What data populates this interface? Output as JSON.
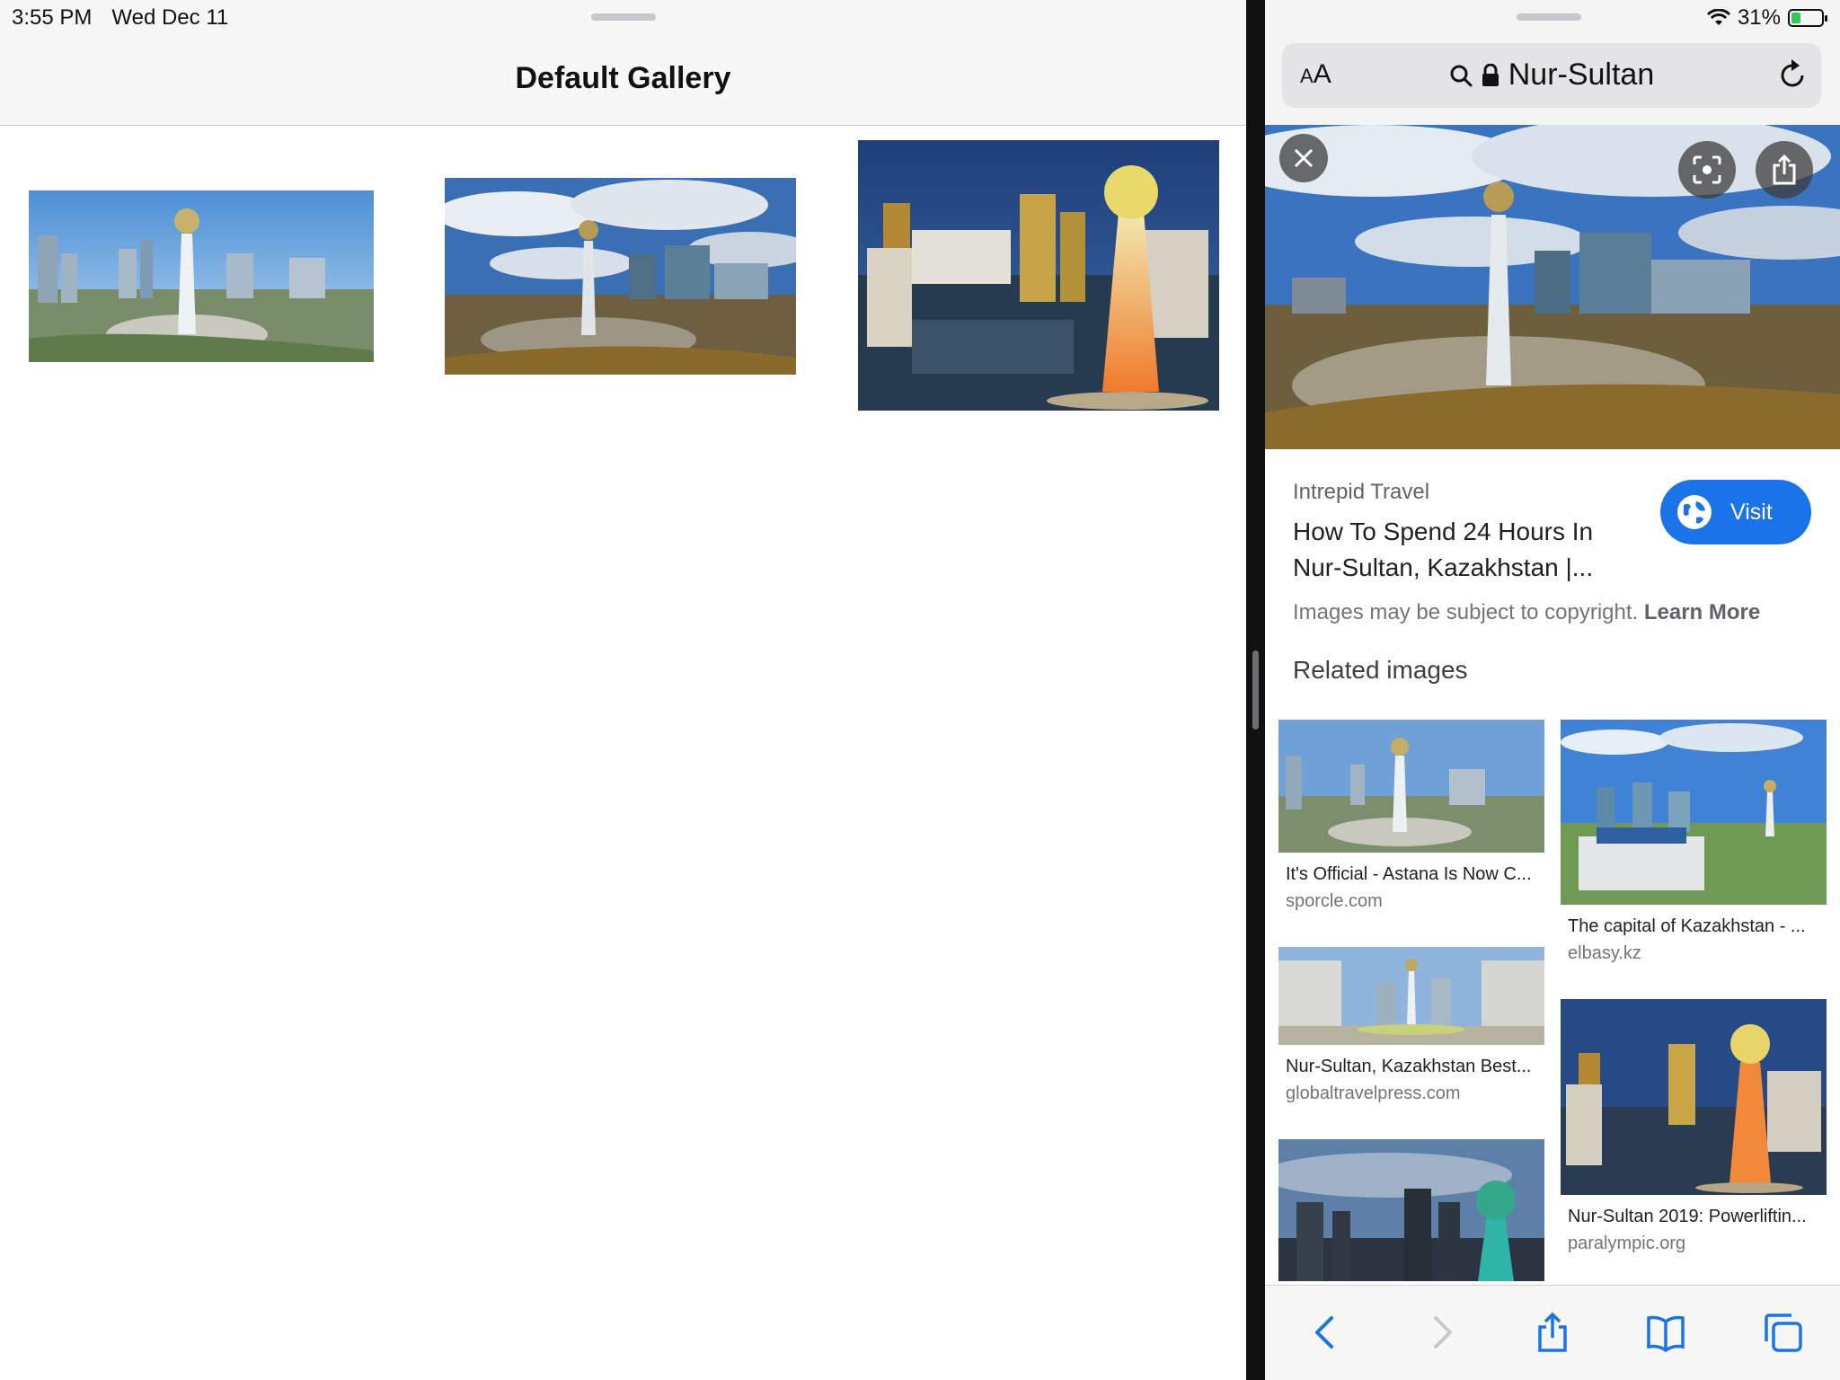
{
  "status": {
    "time": "3:55 PM",
    "date": "Wed Dec 11",
    "battery": "31%",
    "battery_level": 0.31
  },
  "left_app": {
    "title": "Default Gallery"
  },
  "safari": {
    "text_size_button": {
      "small": "A",
      "large": "A"
    },
    "url": "Nur-Sultan",
    "result": {
      "source": "Intrepid Travel",
      "title": "How To Spend 24 Hours In Nur-Sultan, Kazakhstan |...",
      "visit_label": "Visit",
      "copyright": "Images may be subject to copyright.",
      "learn_more": "Learn More"
    },
    "related_heading": "Related images",
    "related": [
      {
        "caption": "It's Official - Astana Is Now C...",
        "domain": "sporcle.com"
      },
      {
        "caption": "The capital of Kazakhstan - ...",
        "domain": "elbasy.kz"
      },
      {
        "caption": "Nur-Sultan, Kazakhstan Best...",
        "domain": "globaltravelpress.com"
      },
      {
        "caption": "Nur-Sultan 2019: Powerliftin...",
        "domain": "paralympic.org"
      }
    ]
  },
  "colors": {
    "accent": "#1a73e8",
    "battery_green": "#34c759"
  },
  "icons": [
    "search-icon",
    "lock-icon",
    "reload-icon",
    "close-icon",
    "lens-icon",
    "share-icon",
    "globe-icon",
    "back-icon",
    "forward-icon",
    "bookmarks-icon",
    "tabs-icon",
    "wifi-icon"
  ]
}
